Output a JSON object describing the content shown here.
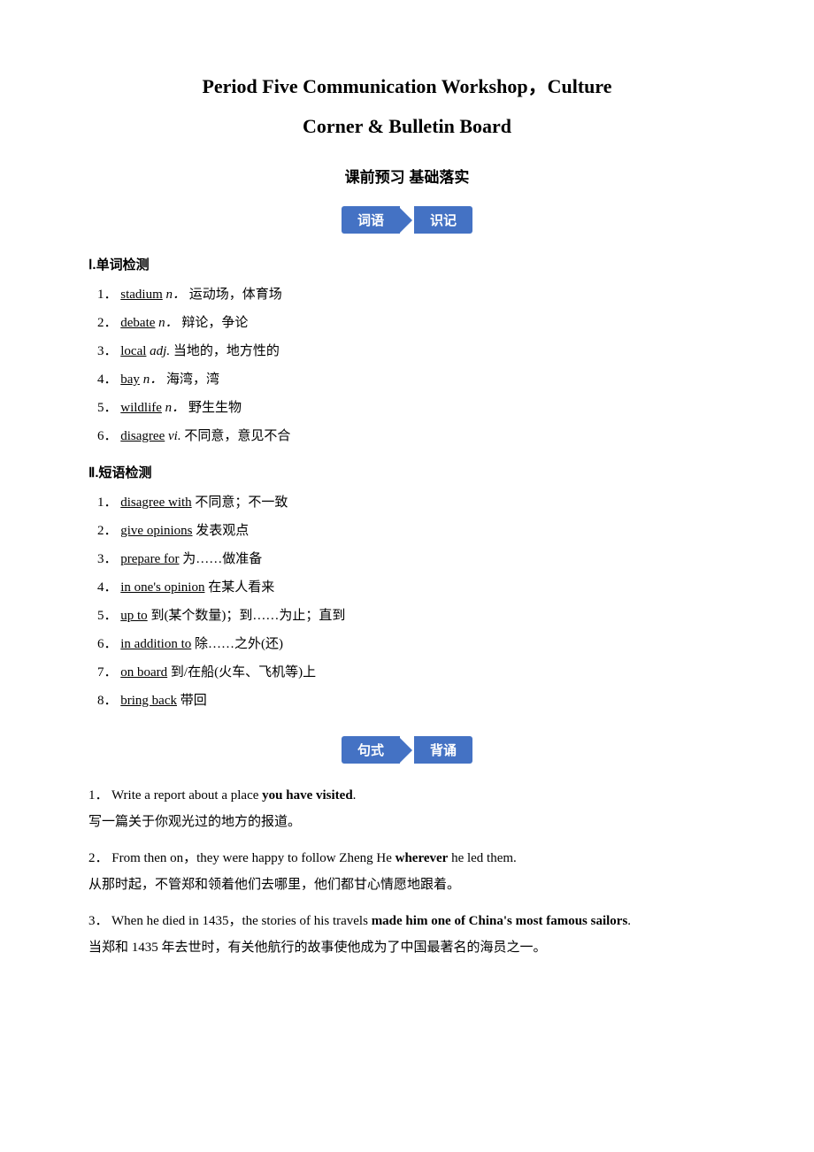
{
  "title_line1": "Period Five    Communication Workshop，Culture",
  "title_line2": "Corner & Bulletin Board",
  "section_header": "课前预习    基础落实",
  "badge1_left": "词语",
  "badge1_right": "识记",
  "badge2_left": "句式",
  "badge2_right": "背诵",
  "roman1": {
    "label": "Ⅰ.单词检测",
    "items": [
      {
        "num": "1．",
        "word": "stadium",
        "pos": "n．",
        "cn": "运动场，体育场"
      },
      {
        "num": "2．",
        "word": "debate",
        "pos": "n．",
        "cn": "辩论，争论"
      },
      {
        "num": "3．",
        "word": "local",
        "pos": "adj.",
        "cn": "当地的，地方性的"
      },
      {
        "num": "4．",
        "word": "bay",
        "pos": "n．",
        "cn": "海湾，湾"
      },
      {
        "num": "5．",
        "word": "wildlife",
        "pos": "n．",
        "cn": "野生生物"
      },
      {
        "num": "6．",
        "word": "disagree",
        "pos": "vi.",
        "cn": "不同意，意见不合"
      }
    ]
  },
  "roman2": {
    "label": "Ⅱ.短语检测",
    "items": [
      {
        "num": "1．",
        "phrase": "disagree with",
        "cn": "不同意；不一致"
      },
      {
        "num": "2．",
        "phrase": "give opinions",
        "cn": "发表观点"
      },
      {
        "num": "3．",
        "phrase": "prepare for",
        "cn": "为……做准备"
      },
      {
        "num": "4．",
        "phrase": "in one's opinion",
        "cn": "在某人看来"
      },
      {
        "num": "5．",
        "phrase": "up to",
        "cn": "到(某个数量)；到……为止；直到"
      },
      {
        "num": "6．",
        "phrase": "in addition to",
        "cn": "除……之外(还)"
      },
      {
        "num": "7．",
        "phrase": "on board",
        "cn": "到/在船(火车、飞机等)上"
      },
      {
        "num": "8．",
        "phrase": "bring back",
        "cn": "带回"
      }
    ]
  },
  "sentences": [
    {
      "num": "1．",
      "en_parts": [
        {
          "text": "Write a report about a place ",
          "bold": false
        },
        {
          "text": "you have visited",
          "bold": true
        }
      ],
      "en_end": ".",
      "cn": "写一篇关于你观光过的地方的报道。"
    },
    {
      "num": "2．",
      "en_parts": [
        {
          "text": "From then on，they were happy to follow Zheng He ",
          "bold": false
        },
        {
          "text": "wherever",
          "bold": true
        },
        {
          "text": " he led them.",
          "bold": false
        }
      ],
      "en_end": "",
      "cn": "从那时起，不管郑和领着他们去哪里，他们都甘心情愿地跟着。"
    },
    {
      "num": "3．",
      "en_parts": [
        {
          "text": "When he died in 1435，the stories of his travels ",
          "bold": false
        },
        {
          "text": "made him one of China's most famous sailors",
          "bold": true
        }
      ],
      "en_end": ".",
      "cn": "当郑和 1435 年去世时，有关他航行的故事使他成为了中国最著名的海员之一。"
    }
  ]
}
